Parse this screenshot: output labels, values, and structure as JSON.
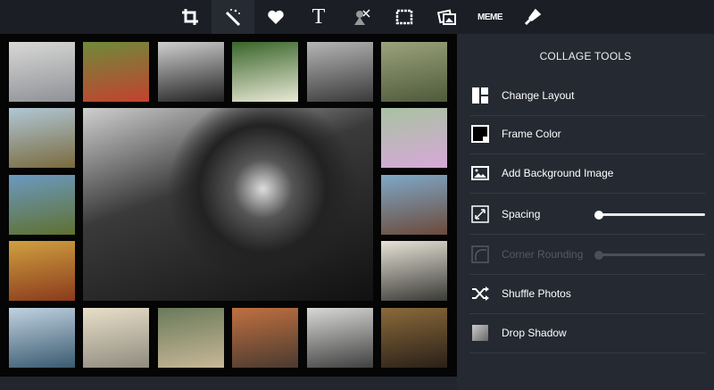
{
  "toolbar": {
    "items": [
      {
        "name": "crop-icon",
        "glyph": ""
      },
      {
        "name": "magic-wand-icon",
        "glyph": ""
      },
      {
        "name": "heart-icon",
        "glyph": ""
      },
      {
        "name": "text-icon",
        "glyph": "T"
      },
      {
        "name": "cutout-icon",
        "glyph": ""
      },
      {
        "name": "frame-icon",
        "glyph": ""
      },
      {
        "name": "photos-icon",
        "glyph": ""
      },
      {
        "name": "meme-icon",
        "glyph": "MEME"
      },
      {
        "name": "brush-icon",
        "glyph": ""
      }
    ],
    "active": 1
  },
  "collage": {
    "tiles": [
      {
        "c": [
          "#d8d8d6",
          "#8e9196"
        ]
      },
      {
        "c": [
          "#6f8a3a",
          "#c3422f"
        ]
      },
      {
        "c": [
          "#cfcfcf",
          "#222"
        ]
      },
      {
        "c": [
          "#39652a",
          "#e9e9d6"
        ]
      },
      {
        "c": [
          "#b5b5b5",
          "#3a3a3a"
        ]
      },
      {
        "c": [
          "#9aa27a",
          "#4f5a3c"
        ]
      },
      {
        "c": [
          "#b0c7d6",
          "#7a6a3d"
        ]
      },
      {
        "c": [
          "#a9c2a2",
          "#d6a8d8"
        ]
      },
      {
        "c": [
          "#6b9ac0",
          "#5f7030"
        ]
      },
      {
        "c": [
          "#7fa8c8",
          "#6b4a3a"
        ]
      },
      {
        "c": [
          "#d0a040",
          "#8a3a1c"
        ]
      },
      {
        "c": [
          "#e6e2d6",
          "#3a3a36"
        ]
      },
      {
        "c": [
          "#c0d2e0",
          "#3a5a70"
        ]
      },
      {
        "c": [
          "#e8dfc8",
          "#908b80"
        ]
      },
      {
        "c": [
          "#6a7a5a",
          "#c8b898"
        ]
      },
      {
        "c": [
          "#c07040",
          "#4a3a30"
        ]
      },
      {
        "c": [
          "#d8d8d6",
          "#404040"
        ]
      },
      {
        "c": [
          "#8a6a3a",
          "#2a2018"
        ]
      }
    ],
    "main": {
      "c": [
        "#cfcfcf",
        "#111"
      ]
    }
  },
  "panel": {
    "title": "COLLAGE TOOLS",
    "items": [
      {
        "label": "Change Layout",
        "icon": "layout-icon"
      },
      {
        "label": "Frame Color",
        "icon": "frame-color-icon"
      },
      {
        "label": "Add Background Image",
        "icon": "image-icon"
      },
      {
        "label": "Spacing",
        "icon": "resize-icon",
        "slider": 0
      },
      {
        "label": "Corner Rounding",
        "icon": "corner-rounding-icon",
        "slider": 0,
        "disabled": true
      },
      {
        "label": "Shuffle Photos",
        "icon": "shuffle-icon"
      },
      {
        "label": "Drop Shadow",
        "icon": "shadow-icon"
      }
    ]
  }
}
